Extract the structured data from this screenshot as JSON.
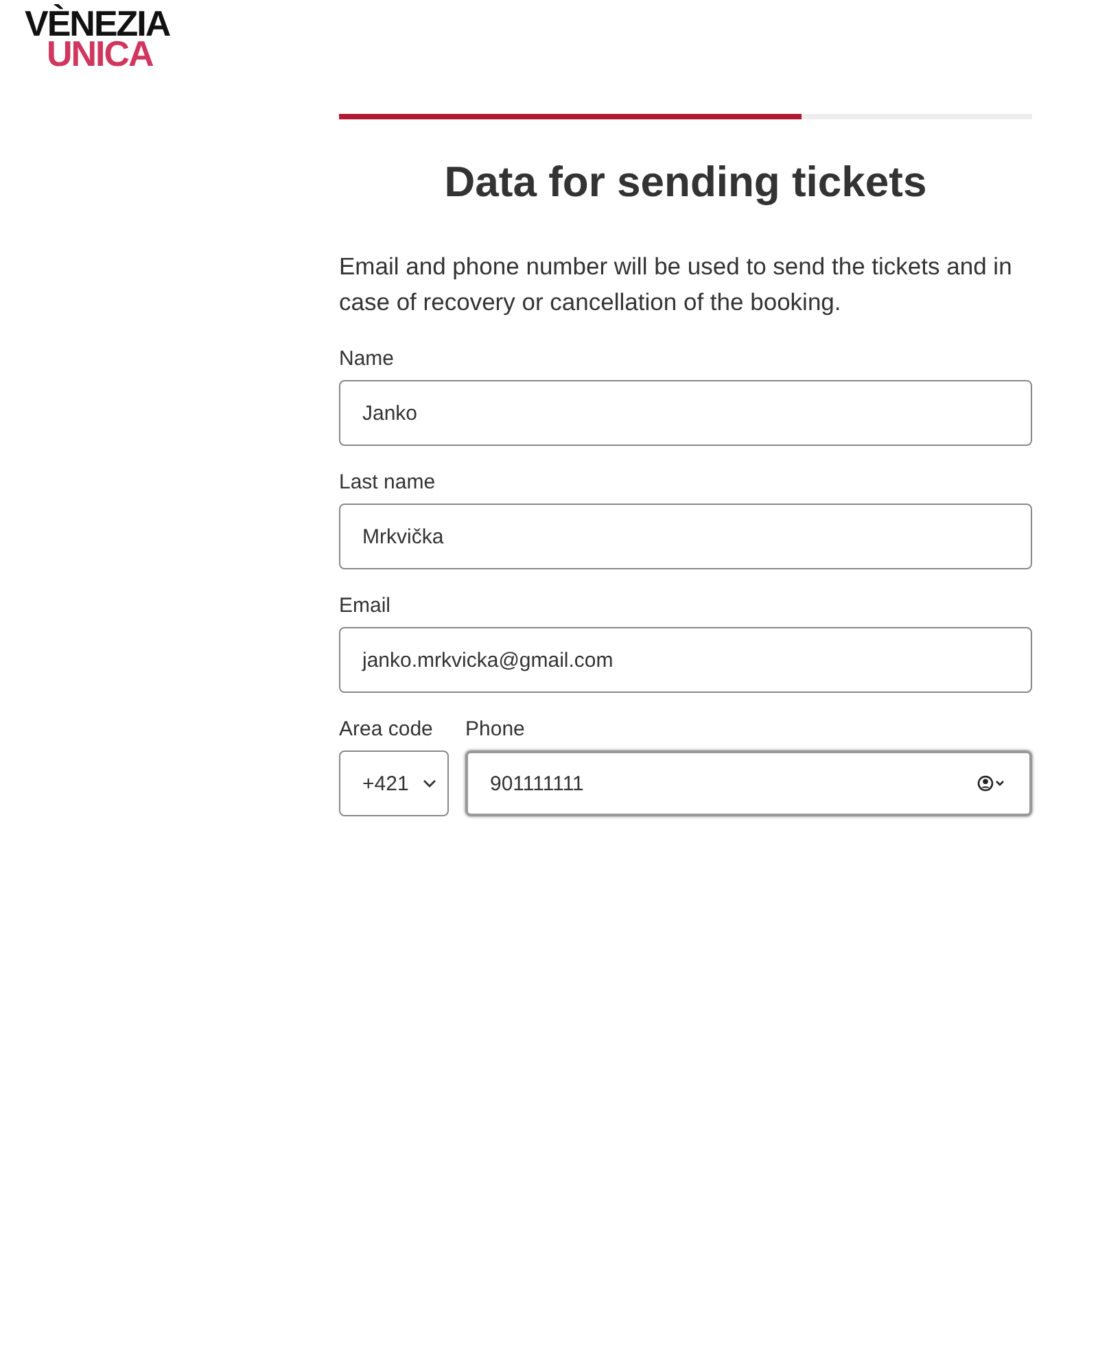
{
  "logo": {
    "line_1": "VÈNEZIA",
    "line_2": "UNICA"
  },
  "progress": {
    "level": 0.667
  },
  "title": "Data for sending tickets",
  "intro": "Email and phone number will be used to send the tickets and in case of recovery or cancellation of the booking.",
  "fields": [
    {
      "label": "Name",
      "value": "Janko",
      "focused": false
    },
    {
      "label": "Last name",
      "value": "Mrkvička",
      "focused": false
    },
    {
      "label": "Email",
      "value": "janko.mrkvicka@gmail.com",
      "focused": false
    }
  ],
  "area_code": {
    "label": "Area code",
    "value": "+421"
  },
  "phone": {
    "label": "Phone",
    "value": "901111111",
    "focused": true
  }
}
